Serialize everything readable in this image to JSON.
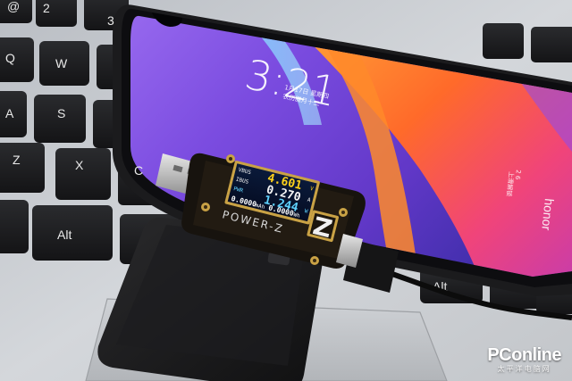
{
  "keyboard": {
    "keys": [
      "@",
      "3",
      "Q",
      "W",
      "A",
      "S",
      "Z",
      "X",
      "C",
      "Alt",
      "Alt",
      "⇧"
    ],
    "top_row_numbers": [
      "2",
      "3"
    ]
  },
  "phone": {
    "lock_time": "3:21",
    "lock_date_lines": [
      "1月17日 星期四",
      "农历腊月十二"
    ],
    "side_lines": [
      "2 6",
      "上滑解锁"
    ],
    "brand": "honor"
  },
  "usb_meter": {
    "brand": "POWER-Z",
    "voltage": "4.601",
    "current": "0.270",
    "power": "1.244",
    "capacity_mah": "0.0000",
    "energy_wh": "0.0000",
    "label_vbus": "VBUS",
    "label_ibus": "IBUS",
    "label_pwr": "PWR",
    "label_mah": "mAh",
    "label_wh": "Wh",
    "unit_v": "V",
    "unit_a": "A",
    "unit_w": "W"
  },
  "watermark": {
    "main": "PConline",
    "sub": "太平洋电脑网"
  },
  "colors": {
    "lcd_yellow": "#ffd21a",
    "lcd_white": "#f4f4f4",
    "lcd_cyan": "#5fd3ff",
    "meter_gold": "#c9a245",
    "screen_purple": "#6b3fd8",
    "screen_orange": "#f2642a"
  }
}
